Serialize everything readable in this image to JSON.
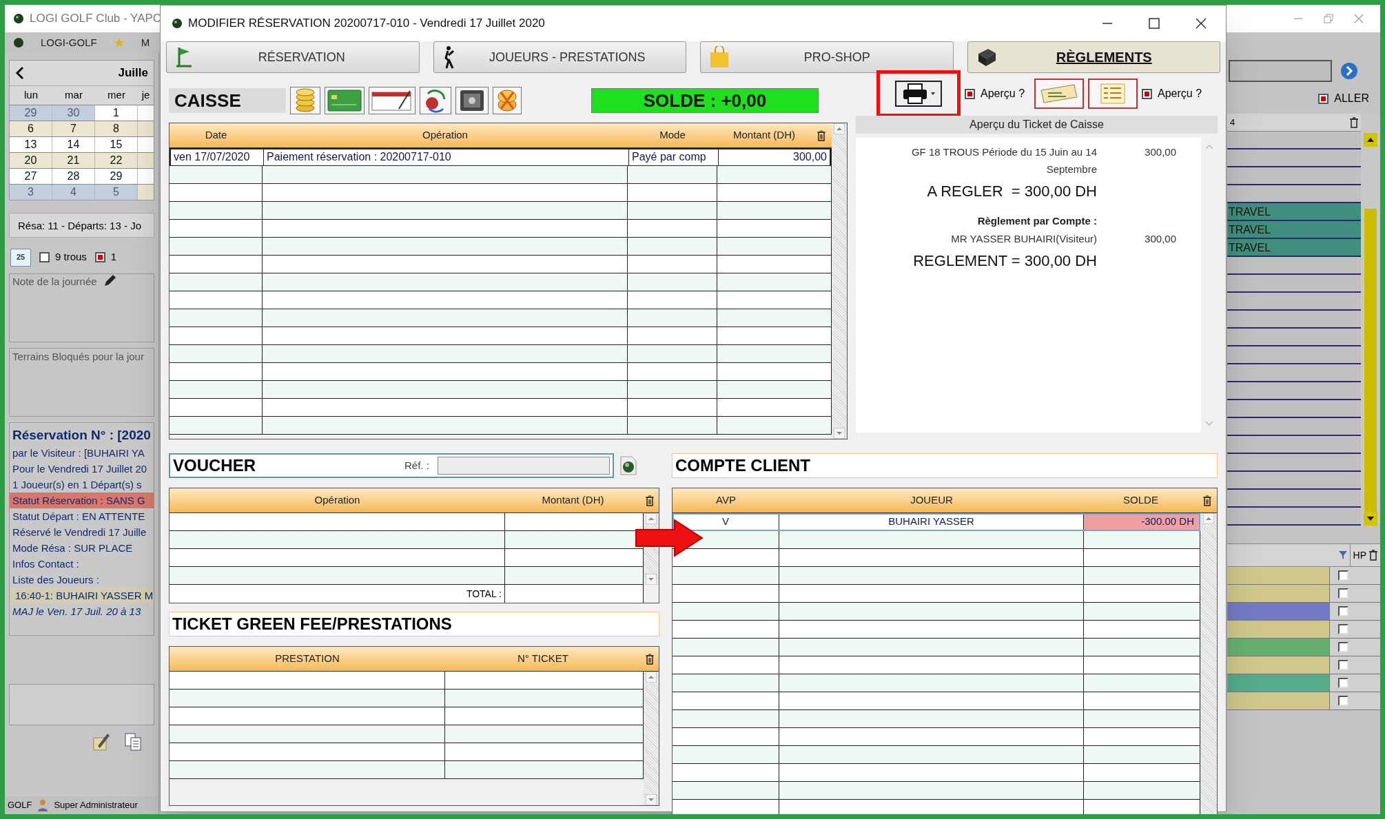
{
  "app": {
    "title": "LOGI GOLF Club - YAPC",
    "menu": [
      "LOGI-GOLF",
      "M"
    ],
    "calendar": {
      "month": "Juille",
      "weekdays": [
        "lun",
        "mar",
        "mer",
        "je"
      ],
      "weeks": [
        [
          {
            "day": "29",
            "muted": true
          },
          {
            "day": "30",
            "muted": true
          },
          {
            "day": "1",
            "muted": false
          }
        ],
        [
          {
            "day": "6",
            "muted": false
          },
          {
            "day": "7",
            "muted": false
          },
          {
            "day": "8",
            "muted": false
          }
        ],
        [
          {
            "day": "13",
            "muted": false
          },
          {
            "day": "14",
            "muted": false
          },
          {
            "day": "15",
            "muted": false
          }
        ],
        [
          {
            "day": "20",
            "muted": false
          },
          {
            "day": "21",
            "muted": false
          },
          {
            "day": "22",
            "muted": false
          }
        ],
        [
          {
            "day": "27",
            "muted": false
          },
          {
            "day": "28",
            "muted": false
          },
          {
            "day": "29",
            "muted": false
          }
        ],
        [
          {
            "day": "3",
            "muted": true
          },
          {
            "day": "4",
            "muted": true
          },
          {
            "day": "5",
            "muted": true
          }
        ]
      ]
    },
    "summary": "Résa: 11 - Départs: 13 - Jo",
    "date_badge": "25",
    "options": [
      {
        "label": "9 trous",
        "checked": false
      },
      {
        "label": "1",
        "checked": true
      }
    ],
    "note_label": "Note de la journée",
    "blocked_label": "Terrains Bloqués pour la jour",
    "reservation": {
      "title": "Réservation N° : [2020",
      "lines": [
        {
          "text": "par le Visiteur : [BUHAIRI YA",
          "kind": "normal"
        },
        {
          "text": "Pour le Vendredi 17 Juillet 20",
          "kind": "normal"
        },
        {
          "text": "1 Joueur(s) en 1 Départ(s) s",
          "kind": "normal"
        },
        {
          "text": "Statut Réservation : SANS G",
          "kind": "alert"
        },
        {
          "text": "Statut Départ : EN ATTENTE",
          "kind": "normal"
        },
        {
          "text": "Réservé le Vendredi 17 Juille",
          "kind": "normal"
        },
        {
          "text": "Mode Résa : SUR PLACE",
          "kind": "normal"
        },
        {
          "text": "Infos Contact :",
          "kind": "normal"
        },
        {
          "text": "Liste des Joueurs :",
          "kind": "normal"
        },
        {
          "text": "16:40-1: BUHAIRI YASSER M",
          "kind": "player"
        },
        {
          "text": "MAJ le Ven. 17 Juil. 20 à 13",
          "kind": "update"
        }
      ]
    },
    "status_bar": [
      "GOLF",
      "Super Administrateur"
    ],
    "right_panel": {
      "go_label": "ALLER",
      "go_checked": true,
      "grid_header": "4",
      "rows": [
        {
          "color": "#c0c0c0"
        },
        {
          "color": "#c0c0c0"
        },
        {
          "color": "#c0c0c0"
        },
        {
          "color": "#c0c0c0"
        },
        {
          "color": "#3f8f7c",
          "label": "TRAVEL"
        },
        {
          "color": "#3f8f7c",
          "label": "TRAVEL"
        },
        {
          "color": "#3f8f7c",
          "label": "TRAVEL"
        },
        {
          "color": "#c0c0c0"
        },
        {
          "color": "#c0c0c0"
        },
        {
          "color": "#c0c0c0"
        },
        {
          "color": "#c0c0c0"
        },
        {
          "color": "#c0c0c0"
        },
        {
          "color": "#c0c0c0"
        },
        {
          "color": "#c0c0c0"
        },
        {
          "color": "#c0c0c0"
        },
        {
          "color": "#c0c0c0"
        },
        {
          "color": "#c0c0c0"
        },
        {
          "color": "#c0c0c0"
        },
        {
          "color": "#c0c0c0"
        },
        {
          "color": "#c0c0c0"
        },
        {
          "color": "#c0c0c0"
        },
        {
          "color": "#c0c0c0"
        }
      ],
      "lower_header": "HP",
      "lower_rows": [
        {
          "color": "#cfc88a",
          "checked": false
        },
        {
          "color": "#cfc88a",
          "checked": false
        },
        {
          "color": "#7479c4",
          "checked": false
        },
        {
          "color": "#cfc88a",
          "checked": false
        },
        {
          "color": "#66b06e",
          "checked": false
        },
        {
          "color": "#cfc88a",
          "checked": false
        },
        {
          "color": "#55ab8a",
          "checked": false
        },
        {
          "color": "#cfc88a",
          "checked": false
        }
      ]
    }
  },
  "dialog": {
    "title": "MODIFIER RÉSERVATION 20200717-010 - Vendredi 17 Juillet 2020",
    "tabs": [
      {
        "label": "RÉSERVATION",
        "selected": false,
        "kind": "flag"
      },
      {
        "label": "JOUEURS - PRESTATIONS",
        "selected": false,
        "kind": "golfer"
      },
      {
        "label": "PRO-SHOP",
        "selected": false,
        "kind": "bag"
      },
      {
        "label": "RÈGLEMENTS",
        "selected": true,
        "kind": "register"
      }
    ],
    "caisse": {
      "title": "CAISSE",
      "solde": "SOLDE : +0,00",
      "columns": [
        "Date",
        "Opération",
        "Mode",
        "Montant (DH)"
      ],
      "rows": [
        [
          "ven 17/07/2020",
          "Paiement réservation : 20200717-010",
          "Payé par comp",
          "300,00"
        ]
      ]
    },
    "print": {
      "preview_options": [
        {
          "label": "Aperçu ?",
          "checked": true
        },
        {
          "label": "Aperçu ?",
          "checked": true
        }
      ]
    },
    "ticket_preview": {
      "title": "Aperçu du Ticket de Caisse",
      "lines": [
        {
          "kind": "item",
          "text": "GF 18 TROUS Période du 15 Juin au 14 Septembre",
          "amount": "300,00"
        },
        {
          "kind": "total",
          "text": "A REGLER  = 300,00 DH"
        },
        {
          "kind": "heading",
          "text": "Règlement par Compte :"
        },
        {
          "kind": "item",
          "text": "MR YASSER BUHAIRI(Visiteur)",
          "amount": "300,00"
        },
        {
          "kind": "total",
          "text": "REGLEMENT = 300,00 DH"
        }
      ]
    },
    "voucher": {
      "title": "VOUCHER",
      "ref_label": "Réf. :",
      "columns": [
        "Opération",
        "Montant (DH)"
      ],
      "total_label": "TOTAL :"
    },
    "ticket_green_fee": {
      "title": "TICKET GREEN FEE/PRESTATIONS",
      "columns": [
        "PRESTATION",
        "N° TICKET"
      ]
    },
    "compte_client": {
      "title": "COMPTE CLIENT",
      "columns": [
        "AVP",
        "JOUEUR",
        "SOLDE"
      ],
      "rows": [
        {
          "avp": "V",
          "joueur": "BUHAIRI YASSER",
          "solde": "-300.00 DH",
          "selected": true
        }
      ]
    }
  }
}
